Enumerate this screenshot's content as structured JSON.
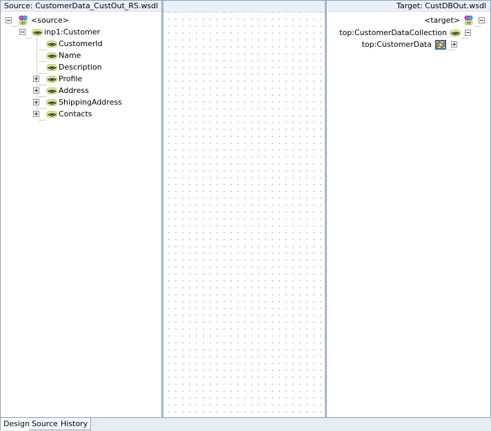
{
  "source_pane": {
    "header": "Source: CustomerData_CustOut_RS.wsdl",
    "root_label": "<source>",
    "customer_node": "inp1:Customer",
    "children": [
      {
        "label": "CustomerId",
        "expandable": false
      },
      {
        "label": "Name",
        "expandable": false
      },
      {
        "label": "Description",
        "expandable": false
      },
      {
        "label": "Profile",
        "expandable": true
      },
      {
        "label": "Address",
        "expandable": true
      },
      {
        "label": "ShippingAddress",
        "expandable": true
      },
      {
        "label": "Contacts",
        "expandable": true
      }
    ]
  },
  "target_pane": {
    "header": "Target: CustDBOut.wsdl",
    "root_label": "<target>",
    "collection_node": "top:CustomerDataCollection",
    "data_node": "top:CustomerData"
  },
  "icons": {
    "element": "<e>",
    "root": "schema-root-icon",
    "collection": "collection-icon"
  },
  "tabs": [
    {
      "label": "Design",
      "active": true
    },
    {
      "label": "Source",
      "active": false
    },
    {
      "label": "History",
      "active": false
    }
  ],
  "colors": {
    "header_bg": "#eaf0f9",
    "border": "#8f9fb5",
    "element_icon_bg": "#d5e8a2"
  }
}
